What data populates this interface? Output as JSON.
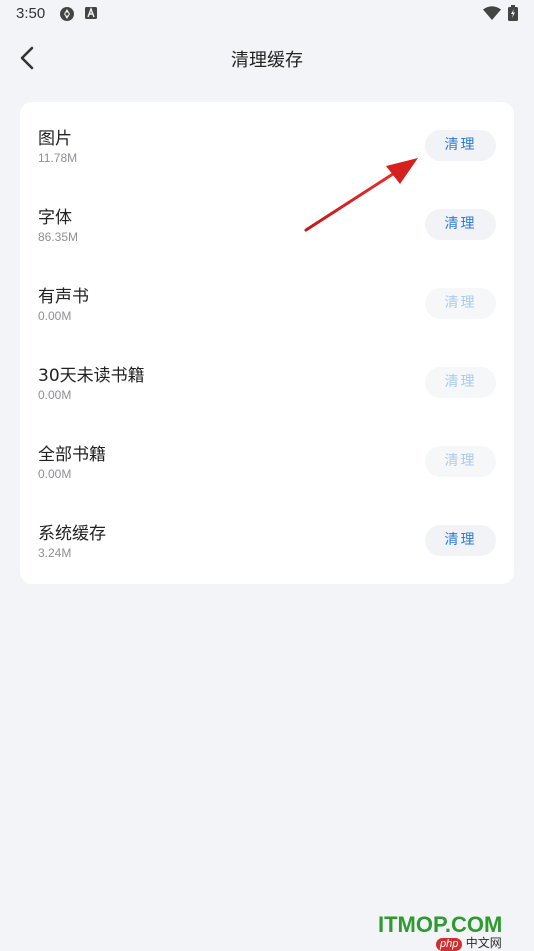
{
  "status_bar": {
    "time": "3:50",
    "icons": [
      "sync-icon",
      "font-app-icon",
      "wifi-icon",
      "battery-icon"
    ]
  },
  "header": {
    "title": "清理缓存",
    "back_icon": "chevron-left-icon"
  },
  "cache_items": [
    {
      "label": "图片",
      "size": "11.78M",
      "button": "清理",
      "enabled": true
    },
    {
      "label": "字体",
      "size": "86.35M",
      "button": "清理",
      "enabled": true
    },
    {
      "label": "有声书",
      "size": "0.00M",
      "button": "清理",
      "enabled": false
    },
    {
      "label": "30天未读书籍",
      "size": "0.00M",
      "button": "清理",
      "enabled": false
    },
    {
      "label": "全部书籍",
      "size": "0.00M",
      "button": "清理",
      "enabled": false
    },
    {
      "label": "系统缓存",
      "size": "3.24M",
      "button": "清理",
      "enabled": true
    }
  ],
  "watermark": {
    "main": "ITMOP.COM",
    "badge": "php",
    "sub": "中文网"
  },
  "colors": {
    "accent": "#2a7bd6",
    "disabled": "#a9cbee",
    "background": "#f3f4f7",
    "annotation_arrow": "#d62020"
  }
}
